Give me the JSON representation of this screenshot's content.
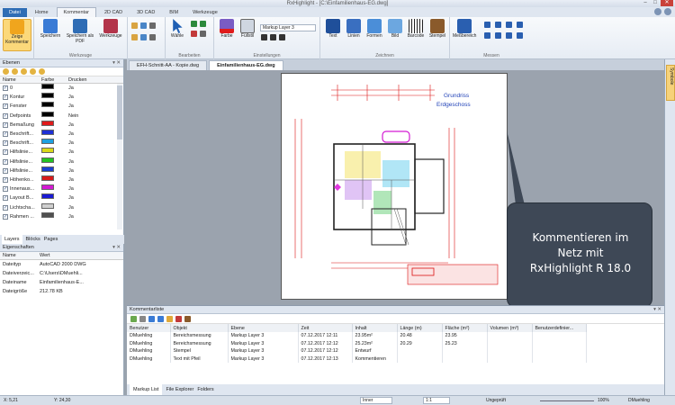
{
  "window": {
    "title": "RxHighlight - [C:\\Einfamilienhaus-EG.dwg]"
  },
  "ribbon_tabs": [
    "Datei",
    "Home",
    "Kommentar",
    "2D CAD",
    "3D CAD",
    "BIM",
    "Werkzeuge"
  ],
  "ribbon": {
    "groups": [
      {
        "label": "",
        "buttons": [
          "Zeige Kommentar"
        ]
      },
      {
        "label": "Werkzeuge",
        "buttons": [
          "Speichern",
          "Speichern als PDF",
          "Werkzeuge"
        ]
      },
      {
        "label": "Bearbeiten",
        "buttons": [
          "Wähle"
        ]
      },
      {
        "label": "Einstellungen",
        "buttons": [
          "Farbe",
          "Füllstil"
        ],
        "layer_combo": "Markup Layer 3"
      },
      {
        "label": "Zeichnen",
        "buttons": [
          "Text",
          "Linien",
          "Formen",
          "Bild",
          "Barcode",
          "Stempel"
        ]
      },
      {
        "label": "Messen",
        "buttons": [
          "Meßbereich"
        ]
      }
    ]
  },
  "layers_panel": {
    "title": "Ebenen",
    "columns": [
      "Name",
      "Farbe",
      "Drucken"
    ],
    "rows": [
      {
        "name": "0",
        "color": "#000000",
        "print": "Ja"
      },
      {
        "name": "Kontur",
        "color": "#000000",
        "print": "Ja"
      },
      {
        "name": "Fenster",
        "color": "#000000",
        "print": "Ja"
      },
      {
        "name": "Defpoints",
        "color": "#000000",
        "print": "Nein"
      },
      {
        "name": "Bemaßung",
        "color": "#e01b1b",
        "print": "Ja"
      },
      {
        "name": "Beschrift...",
        "color": "#1e2fd6",
        "print": "Ja"
      },
      {
        "name": "Beschrift...",
        "color": "#1ea0e0",
        "print": "Ja"
      },
      {
        "name": "Hilfslinie...",
        "color": "#d9d91a",
        "print": "Ja"
      },
      {
        "name": "Hilfslinie...",
        "color": "#22c322",
        "print": "Ja"
      },
      {
        "name": "Hilfslinie...",
        "color": "#1a3fd0",
        "print": "Ja"
      },
      {
        "name": "Höhenko...",
        "color": "#d91a1a",
        "print": "Ja"
      },
      {
        "name": "Innenaus...",
        "color": "#d41ad4",
        "print": "Ja"
      },
      {
        "name": "Layout B...",
        "color": "#1a1ad4",
        "print": "Ja"
      },
      {
        "name": "Lichtscha...",
        "color": "#cfcfcf",
        "print": "Ja"
      },
      {
        "name": "Rahmen ...",
        "color": "#505050",
        "print": "Ja"
      }
    ],
    "tabs": [
      "Layers",
      "Blöcks",
      "Pages"
    ]
  },
  "properties_panel": {
    "title": "Eigenschaften",
    "columns": [
      "Name",
      "Wert"
    ],
    "rows": [
      {
        "key": "Dateityp",
        "value": "AutoCAD 2000 DWG"
      },
      {
        "key": "Dateiverzeic...",
        "value": "C:\\Users\\DMuehli..."
      },
      {
        "key": "Dateiname",
        "value": "Einfamilienhaus-E..."
      },
      {
        "key": "Dateigröße",
        "value": "212.78 KB"
      }
    ]
  },
  "doc_tabs": [
    "EFH-Schnitt-AA - Kopie.dwg",
    "Einfamilienhaus-EG.dwg"
  ],
  "drawing": {
    "title_line1": "Grundriss",
    "title_line2": "Erdgeschoss"
  },
  "callout": {
    "text_line1": "Kommentieren im",
    "text_line2": "Netz mit",
    "text_line3": "RxHighlight R 18.0"
  },
  "comments_panel": {
    "title": "Kommentarliste",
    "columns": [
      "Benutzer",
      "Objekt",
      "Ebene",
      "Zeit",
      "Inhalt",
      "Länge (m)",
      "Fläche (m²)",
      "Volumen (m³)",
      "Benutzerdefinier..."
    ],
    "rows": [
      [
        "DMuehling",
        "Bereichsmessung",
        "Markup Layer 3",
        "07.12.2017 12:11",
        "23.95m²",
        "20.48",
        "23.95",
        "",
        ""
      ],
      [
        "DMuehling",
        "Bereichsmessung",
        "Markup Layer 3",
        "07.12.2017 12:12",
        "25.23m²",
        "20.29",
        "25.23",
        "",
        ""
      ],
      [
        "DMuehling",
        "Stempel",
        "Markup Layer 3",
        "07.12.2017 12:12",
        "Entwurf",
        "",
        "",
        "",
        ""
      ],
      [
        "DMuehling",
        "Text mit Pfeil",
        "Markup Layer 3",
        "07.12.2017 12:13",
        "Kommentieren",
        "",
        "",
        "",
        ""
      ]
    ],
    "tabs": [
      "Markup List",
      "File Explorer",
      "Folders"
    ]
  },
  "status": {
    "x": "X: 5,21",
    "y": "Y: 24,30",
    "combo": "Inner",
    "zoom": "1:1",
    "snap": "Ungeprüft",
    "zoom_percent": "100%",
    "user": "DMuehling"
  },
  "side_tab": "Symbole"
}
